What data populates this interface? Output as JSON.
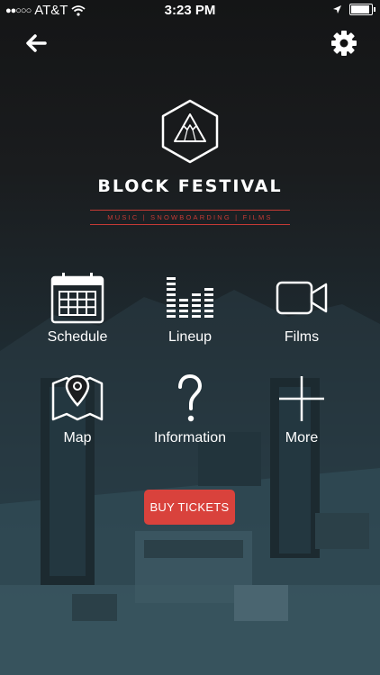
{
  "status_bar": {
    "carrier": "AT&T",
    "time": "3:23 PM",
    "battery_level": 0.85
  },
  "nav": {
    "back_icon": "arrow-left-icon",
    "settings_icon": "gear-icon"
  },
  "brand": {
    "title": "BLOCK FESTIVAL",
    "tagline": "MUSIC | SNOWBOARDING | FILMS",
    "logo_icon": "mountain-hexagon-logo"
  },
  "menu": [
    {
      "label": "Schedule",
      "icon": "calendar-icon"
    },
    {
      "label": "Lineup",
      "icon": "equalizer-icon"
    },
    {
      "label": "Films",
      "icon": "video-camera-icon"
    },
    {
      "label": "Map",
      "icon": "map-pin-icon"
    },
    {
      "label": "Information",
      "icon": "question-mark-icon"
    },
    {
      "label": "More",
      "icon": "plus-icon"
    }
  ],
  "cta": {
    "label": "BUY TICKETS"
  },
  "colors": {
    "accent": "#d9423c",
    "background": "#1a1c1e",
    "text": "#ffffff"
  }
}
